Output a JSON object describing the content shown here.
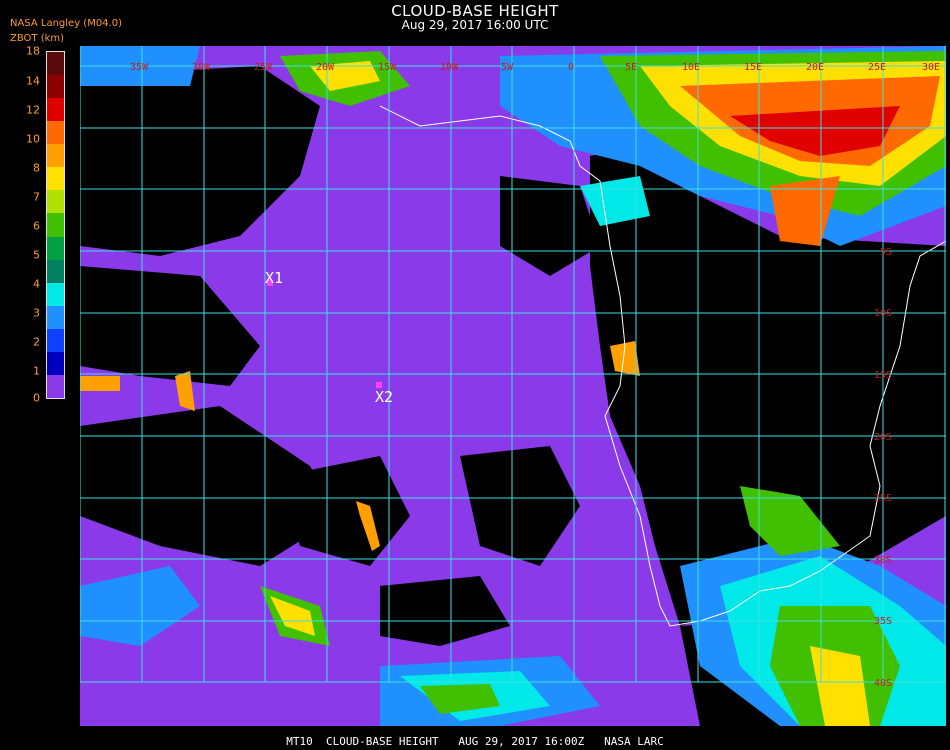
{
  "header": {
    "title": "CLOUD-BASE HEIGHT",
    "subtitle": "Aug 29, 2017 16:00 UTC",
    "credit": "NASA Langley (M04.0)",
    "colorbar_label": "ZBOT (km)"
  },
  "colorbar": {
    "ticks": [
      "18",
      "14",
      "12",
      "10",
      "8",
      "7",
      "6",
      "5",
      "4",
      "3",
      "2",
      "1",
      "0"
    ],
    "colors": [
      "#5a0a0a",
      "#8c0000",
      "#e00000",
      "#ff6a00",
      "#ffa000",
      "#ffe000",
      "#b0e000",
      "#40c000",
      "#00a040",
      "#008060",
      "#00e8e8",
      "#2090ff",
      "#1040ff",
      "#0000c0",
      "#8a3ae8"
    ]
  },
  "map": {
    "longitude_labels": [
      "35W",
      "30W",
      "25W",
      "20W",
      "15W",
      "10W",
      "5W",
      "0",
      "5E",
      "10E",
      "15E",
      "20E",
      "25E",
      "30E"
    ],
    "latitude_labels": [
      "5S",
      "10S",
      "15S",
      "20S",
      "25S",
      "30S",
      "35S",
      "40S"
    ],
    "markers": [
      {
        "label": "X1"
      },
      {
        "label": "X2"
      }
    ],
    "colors": {
      "ocean_low_cloud": "#8a3ae8",
      "clear": "#000000",
      "grid": "#3ee0e0",
      "coast": "#ffffff",
      "marker": "#ff40ff"
    }
  },
  "footer": {
    "text": "MT10  CLOUD-BASE HEIGHT   AUG 29, 2017 16:00Z   NASA LARC"
  }
}
